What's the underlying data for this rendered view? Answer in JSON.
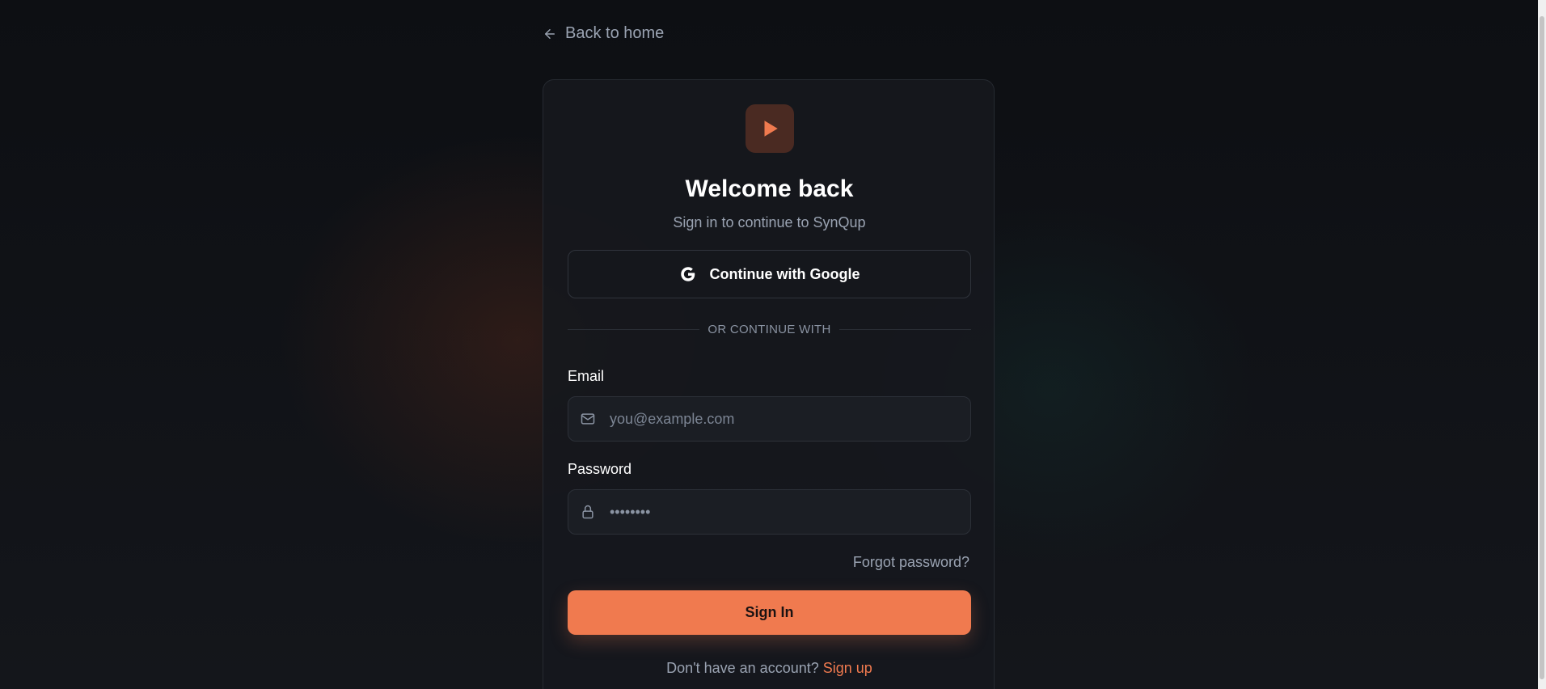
{
  "nav": {
    "back_label": "Back to home"
  },
  "header": {
    "title": "Welcome back",
    "subtitle": "Sign in to continue to SynQup"
  },
  "oauth": {
    "google_label": "Continue with Google"
  },
  "divider": {
    "text": "OR CONTINUE WITH"
  },
  "form": {
    "email_label": "Email",
    "email_placeholder": "you@example.com",
    "password_label": "Password",
    "password_value": "••••••••",
    "forgot_label": "Forgot password?",
    "submit_label": "Sign In"
  },
  "footer": {
    "prompt": "Don't have an account?",
    "signup_label": "Sign up"
  },
  "icons": {
    "back": "arrow-left-icon",
    "logo": "play-icon",
    "google": "google-icon",
    "email": "mail-icon",
    "password": "lock-icon"
  },
  "colors": {
    "accent": "#f07a4f",
    "background": "#111317",
    "card": "#16181d"
  }
}
